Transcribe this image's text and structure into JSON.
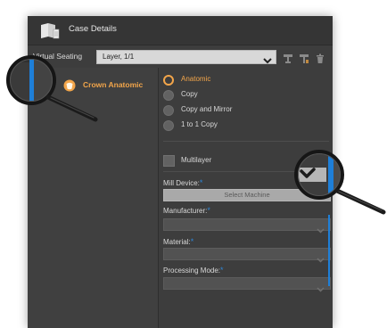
{
  "window": {
    "title": "Case Details"
  },
  "seating": {
    "label": "Virtual Seating",
    "selected": "Layer, 1/1"
  },
  "tree": {
    "items": [
      {
        "label": "Crown Anatomic"
      }
    ]
  },
  "copy_mode": {
    "options": [
      {
        "label": "Anatomic",
        "selected": true
      },
      {
        "label": "Copy",
        "selected": false
      },
      {
        "label": "Copy and Mirror",
        "selected": false
      },
      {
        "label": "1 to 1 Copy",
        "selected": false
      }
    ]
  },
  "multilayer": {
    "label": "Multilayer",
    "checked": false
  },
  "mill_device": {
    "label": "Mill Device:",
    "value": "Select Machine"
  },
  "manufacturer": {
    "label": "Manufacturer:",
    "value": ""
  },
  "material": {
    "label": "Material:",
    "value": ""
  },
  "processing_mode": {
    "label": "Processing Mode:",
    "value": ""
  },
  "colors": {
    "accent": "#f2a54a",
    "required": "#2f86d6",
    "focus": "#1e7fd8",
    "panel": "#3d3d3d"
  }
}
